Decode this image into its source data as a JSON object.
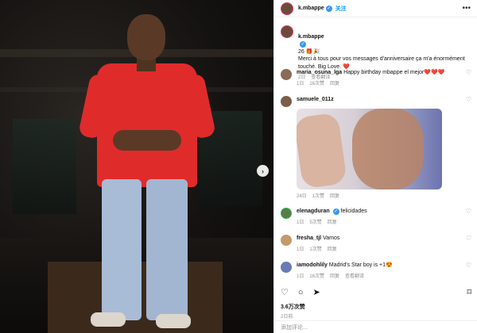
{
  "post": {
    "author": "k.mbappe",
    "follow_label": "关注",
    "more_icon": "ellipsis-icon",
    "carousel_next_icon": "chevron-right-icon"
  },
  "caption": {
    "username": "k.mbappe",
    "text": "26 🎁🎉\nMerci à tous pour vos messages d'anniversaire ça m'a énormément touché. Big Love. ❤️",
    "time": "2日",
    "translate": "查看翻译"
  },
  "comments": [
    {
      "username": "maria_osuna_lga",
      "text": "Happy birthday mbappe el mejor❤️❤️❤️",
      "time": "1日",
      "likes": "16次赞",
      "reply": "回复"
    },
    {
      "username": "samuele_011z",
      "text": "",
      "time": "24日",
      "likes": "1次赞",
      "reply": "回复"
    },
    {
      "username": "elenagduran",
      "text": "felicidades",
      "time": "1日",
      "likes": "5次赞",
      "reply": "回复"
    },
    {
      "username": "fresha_tjl",
      "text": "Vamos",
      "time": "1日",
      "likes": "1次赞",
      "reply": "回复"
    },
    {
      "username": "iamodohlily",
      "text": "Madrid's Star boy is +1😍",
      "time": "1日",
      "likes": "16次赞",
      "reply": "回复",
      "translate": "查看翻译"
    }
  ],
  "actions": {
    "like_icon": "heart-icon",
    "comment_icon": "comment-icon",
    "share_icon": "send-icon",
    "save_icon": "bookmark-icon"
  },
  "likes_count": "3.6万次赞",
  "post_time": "2日前",
  "add_comment_placeholder": "添加评论..."
}
